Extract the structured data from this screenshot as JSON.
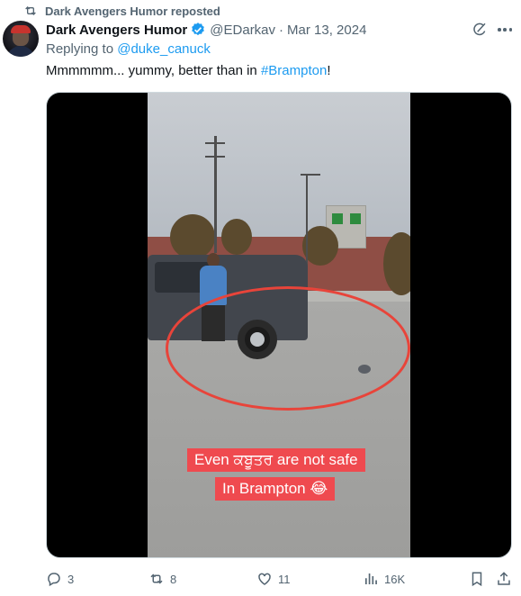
{
  "repost": {
    "label": "Dark Avengers Humor reposted",
    "icon": "repost-icon"
  },
  "tweet": {
    "display_name": "Dark Avengers Humor",
    "verified_icon": "verified-badge-icon",
    "handle": "@EDarkav",
    "separator": "·",
    "date": "Mar 13, 2024",
    "replying_prefix": "Replying to ",
    "replying_to": "@duke_canuck",
    "text_before": "Mmmmmm... yummy, better than in ",
    "hashtag": "#Brampton",
    "text_after": "!"
  },
  "media": {
    "caption_line_1": "Even ਕਬੂਤਰ are not safe",
    "caption_line_2": "In Brampton 😂",
    "highlight_color": "#e8443a",
    "caption_bg": "#ef4a4f"
  },
  "actions": {
    "replies": "3",
    "reposts": "8",
    "likes": "11",
    "views": "16K"
  },
  "colors": {
    "text": "#0f1419",
    "muted": "#536471",
    "accent": "#1d9bf0"
  }
}
